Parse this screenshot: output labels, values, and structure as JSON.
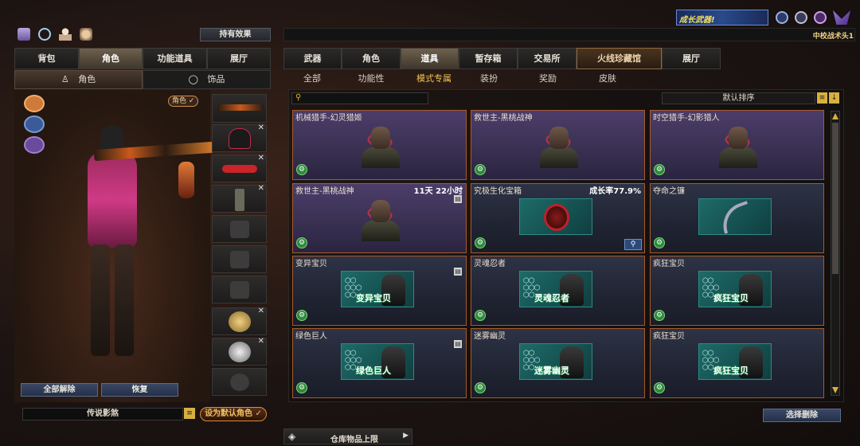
{
  "top_icons": [
    "chart-icon",
    "eye-icon",
    "figure-icon",
    "bag-icon"
  ],
  "effect_button": "持有效果",
  "left_tabs": [
    "背包",
    "角色",
    "功能道具",
    "展厅"
  ],
  "left_tab_active": 1,
  "left_subtabs": [
    "角色",
    "饰品"
  ],
  "role_badge": "角色 ✓",
  "left_buttons": {
    "unequip_all": "全部解除",
    "restore": "恢复"
  },
  "set_default": "设为默认角色 ✓",
  "character_name": "传说影煞",
  "banner_text": "成长武器!",
  "rank_text": "中校战术头1",
  "main_tabs": [
    "武器",
    "角色",
    "道具",
    "暂存箱",
    "交易所",
    "火线珍藏馆",
    "展厅"
  ],
  "main_tab_active": 2,
  "sub_tabs": [
    "全部",
    "功能性",
    "模式专属",
    "装扮",
    "奖励",
    "皮肤"
  ],
  "sub_tab_active": 2,
  "search_placeholder": "",
  "sort_label": "默认排序",
  "cards": [
    {
      "name": "机械猎手-幻灵猎姬",
      "info": "",
      "style": "purple",
      "kind": "portrait",
      "caption": ""
    },
    {
      "name": "救世主-黑桃战神",
      "info": "",
      "style": "purple",
      "kind": "portrait",
      "caption": ""
    },
    {
      "name": "时空猎手-幻影猎人",
      "info": "",
      "style": "purple",
      "kind": "portrait",
      "caption": ""
    },
    {
      "name": "救世主-黑桃战神",
      "info": "11天 22小时",
      "style": "purple",
      "kind": "portrait",
      "caption": ""
    },
    {
      "name": "究极生化宝箱",
      "info": "成长率77.9%",
      "style": "blue",
      "kind": "box",
      "caption": ""
    },
    {
      "name": "夺命之镰",
      "info": "",
      "style": "blue",
      "kind": "scythe",
      "caption": ""
    },
    {
      "name": "变异宝贝",
      "info": "",
      "style": "blue",
      "kind": "zombie",
      "caption": "变异宝贝"
    },
    {
      "name": "灵魂忍者",
      "info": "",
      "style": "blue",
      "kind": "zombie",
      "caption": "灵魂忍者"
    },
    {
      "name": "疯狂宝贝",
      "info": "",
      "style": "blue",
      "kind": "zombie",
      "caption": "疯狂宝贝"
    },
    {
      "name": "绿色巨人",
      "info": "",
      "style": "blue",
      "kind": "zombie",
      "caption": "绿色巨人"
    },
    {
      "name": "迷雾幽灵",
      "info": "",
      "style": "blue",
      "kind": "zombie",
      "caption": "迷雾幽灵"
    },
    {
      "name": "疯狂宝贝",
      "info": "",
      "style": "blue",
      "kind": "zombie",
      "caption": "疯狂宝贝"
    }
  ],
  "select_delete": "选择删除",
  "warehouse_limit": "仓库物品上限",
  "colors": {
    "accent_orange": "#e07a2e",
    "active_yellow": "#f2c34a",
    "card_border": "#a85a2a"
  }
}
